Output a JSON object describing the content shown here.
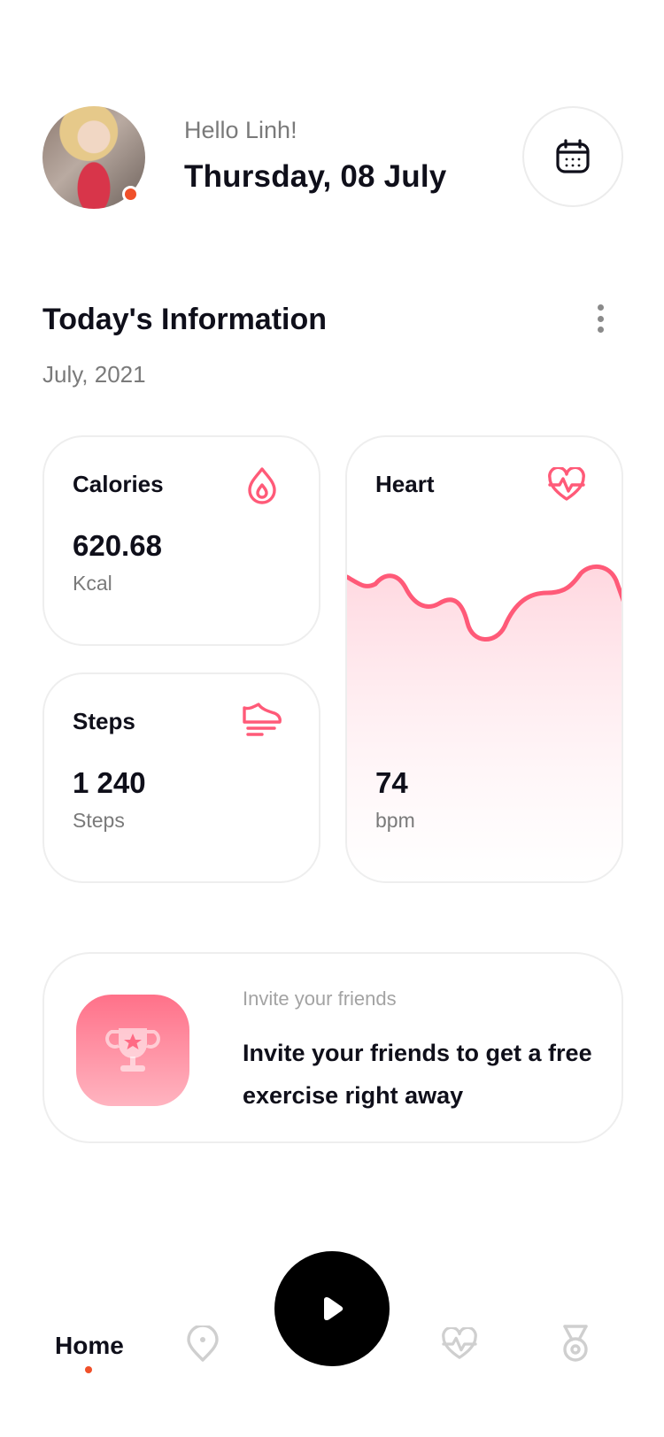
{
  "header": {
    "greeting": "Hello Linh!",
    "date": "Thursday, 08 July",
    "avatar_icon": "user-avatar-photo",
    "calendar_icon": "calendar-icon"
  },
  "section": {
    "title": "Today's Information",
    "subtitle": "July, 2021",
    "more_icon": "more-vertical-icon"
  },
  "cards": {
    "calories": {
      "title": "Calories",
      "value": "620.68",
      "unit": "Kcal",
      "icon": "flame-drop-icon"
    },
    "steps": {
      "title": "Steps",
      "value": "1 240",
      "unit": "Steps",
      "icon": "sneaker-icon"
    },
    "heart": {
      "title": "Heart",
      "value": "74",
      "unit": "bpm",
      "icon": "heart-pulse-icon"
    }
  },
  "invite": {
    "kicker": "Invite your friends",
    "text": "Invite your friends to get a free exercise right away",
    "icon": "trophy-icon"
  },
  "nav": {
    "home_label": "Home",
    "items": [
      "map-pin-icon",
      "play-icon",
      "heart-pulse-icon",
      "medal-icon"
    ]
  },
  "colors": {
    "accent": "#ff5a78",
    "dot": "#f0502a",
    "text": "#0f0f1a",
    "muted": "#7a7a7a",
    "nav_inactive": "#cfcfcf"
  }
}
